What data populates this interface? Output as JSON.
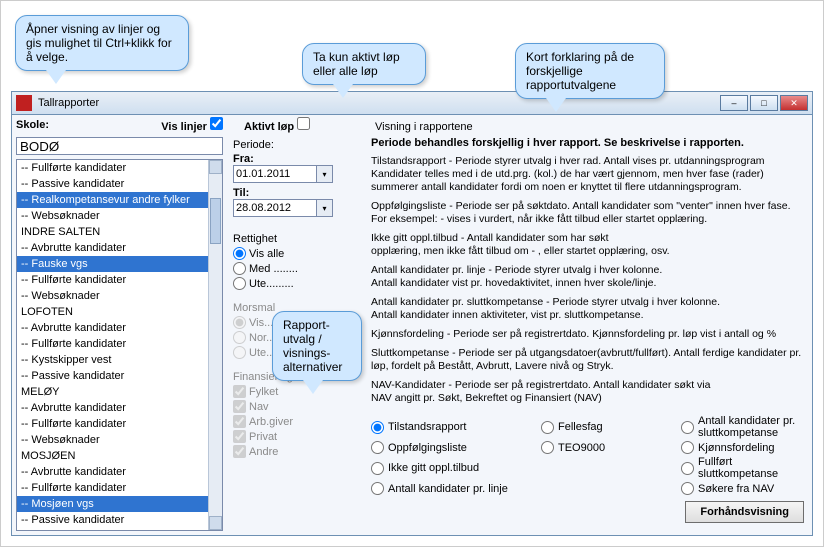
{
  "callouts": {
    "c1": "Åpner visning av linjer og gis mulighet til Ctrl+klikk for å velge.",
    "c2": "Ta kun aktivt løp eller alle løp",
    "c3": "Kort forklaring på de forskjellige rapportutvalgene",
    "c4": "Rapport-utvalg / visnings-alternativer"
  },
  "window_title": "Tallrapporter",
  "labels": {
    "skole": "Skole:",
    "vis_linjer": "Vis linjer",
    "aktivt_lop": "Aktivt løp",
    "periode": "Periode:",
    "fra": "Fra:",
    "til": "Til:",
    "rettighet": "Rettighet",
    "vis_alle": "Vis alle",
    "med": "Med ........",
    "uten": "Ute.........",
    "morsmal": "Morsmal",
    "m_vis": "Vis.........",
    "m_nor": "Nor........",
    "m_ute": "Ute.......sk",
    "finansiering": "Finansiering",
    "fylket": "Fylket",
    "nav": "Nav",
    "arb_giver": "Arb.giver",
    "privat": "Privat",
    "andre": "Andre",
    "visning_i": "Visning i rapportene",
    "preview": "Forhåndsvisning"
  },
  "school_value": "BODØ",
  "dates": {
    "fra": "01.01.2011",
    "til": "28.08.2012"
  },
  "list": [
    {
      "t": "-- Fullførte kandidater",
      "s": false
    },
    {
      "t": "-- Passive kandidater",
      "s": false
    },
    {
      "t": "-- Realkompetansevur andre fylker",
      "s": true
    },
    {
      "t": "-- Websøknader",
      "s": false
    },
    {
      "t": "INDRE SALTEN",
      "s": false
    },
    {
      "t": "-- Avbrutte kandidater",
      "s": false
    },
    {
      "t": "-- Fauske vgs",
      "s": true
    },
    {
      "t": "-- Fullførte kandidater",
      "s": false
    },
    {
      "t": "-- Websøknader",
      "s": false
    },
    {
      "t": "LOFOTEN",
      "s": false
    },
    {
      "t": "-- Avbrutte kandidater",
      "s": false
    },
    {
      "t": "-- Fullførte kandidater",
      "s": false
    },
    {
      "t": "-- Kystskipper vest",
      "s": false
    },
    {
      "t": "-- Passive kandidater",
      "s": false
    },
    {
      "t": "MELØY",
      "s": false
    },
    {
      "t": "-- Avbrutte kandidater",
      "s": false
    },
    {
      "t": "-- Fullførte kandidater",
      "s": false
    },
    {
      "t": "-- Websøknader",
      "s": false
    },
    {
      "t": "MOSJØEN",
      "s": false
    },
    {
      "t": "-- Avbrutte kandidater",
      "s": false
    },
    {
      "t": "-- Fullførte kandidater",
      "s": false
    },
    {
      "t": "-- Mosjøen vgs",
      "s": true
    },
    {
      "t": "-- Passive kandidater",
      "s": false
    }
  ],
  "desc": {
    "bold": "Periode behandles forskjellig i hver rapport. Se beskrivelse i rapporten.",
    "p1": "Tilstandsrapport - Periode styrer utvalg i hver rad. Antall vises pr. utdanningsprogram Kandidater telles med i de utd.prg. (kol.) de har vært gjennom, men hver fase (rader) summerer antall kandidater fordi om noen er knyttet til flere utdanningsprogram.",
    "p2": "Oppfølgingsliste - Periode ser på søktdato. Antall kandidater som \"venter\" innen hver fase. For eksempel: - vises i vurdert, når ikke fått tilbud eller startet opplæring.",
    "p3": "Ikke gitt oppl.tilbud - Antall kandidater som har søkt\nopplæring, men ikke fått tilbud om - , eller startet opplæring, osv.",
    "p4": "Antall kandidater pr. linje - Periode styrer utvalg i hver kolonne.\nAntall kandidater vist pr. hovedaktivitet, innen hver skole/linje.",
    "p5": "Antall kandidater pr. sluttkompetanse - Periode styrer utvalg i hver kolonne.\nAntall kandidater innen aktiviteter, vist pr. sluttkompetanse.",
    "p6": "Kjønnsfordeling - Periode ser på registrertdato. Kjønnsfordeling pr. løp vist i antall og %",
    "p7": "Sluttkompetanse - Periode ser på utgangsdatoer(avbrutt/fullført). Antall ferdige kandidater pr. løp, fordelt på Bestått, Avbrutt, Lavere nivå og Stryk.",
    "p8": "NAV-Kandidater - Periode ser på registrertdato. Antall kandidater søkt via\nNAV angitt pr. Søkt, Bekreftet og Finansiert (NAV)"
  },
  "reports": {
    "r1": "Tilstandsrapport",
    "r2": "Oppfølgingsliste",
    "r3": "Ikke gitt oppl.tilbud",
    "r4": "Antall kandidater pr. linje",
    "r5": "Fellesfag",
    "r6": "TEO9000",
    "r7": "Antall kandidater pr. sluttkompetanse",
    "r8": "Kjønnsfordeling",
    "r9": "Fullført sluttkompetanse",
    "r10": "Søkere fra NAV"
  }
}
